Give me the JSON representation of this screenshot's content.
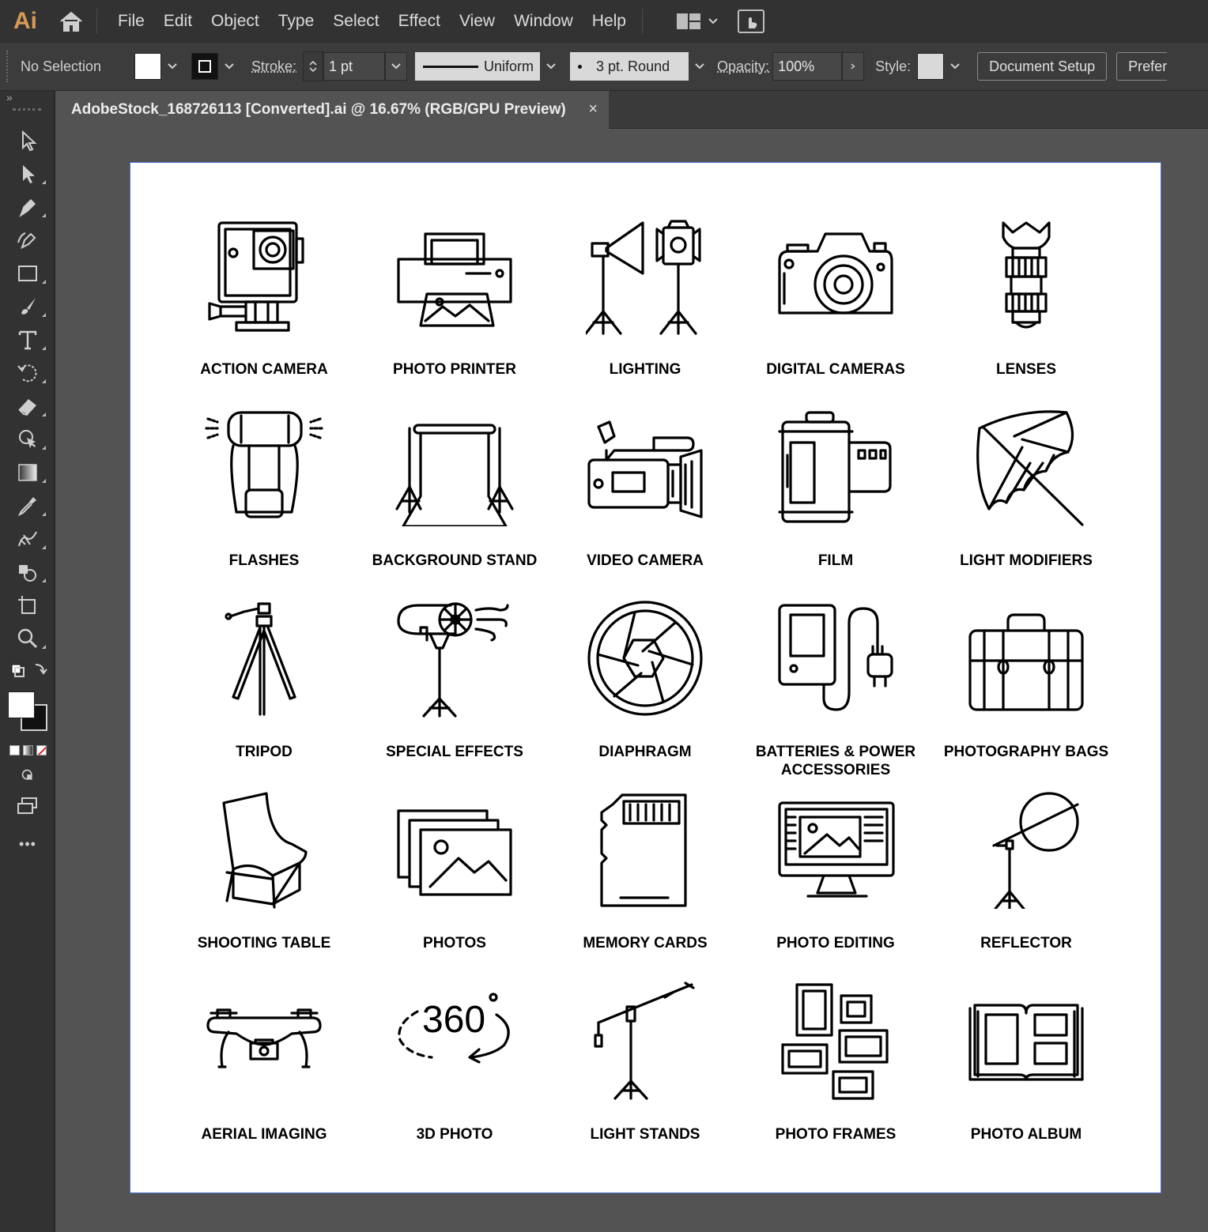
{
  "app": {
    "logo": "Ai"
  },
  "menu": [
    "File",
    "Edit",
    "Object",
    "Type",
    "Select",
    "Effect",
    "View",
    "Window",
    "Help"
  ],
  "control": {
    "selection": "No Selection",
    "stroke_label": "Stroke:",
    "stroke_value": "1 pt",
    "profile": "Uniform",
    "brush": "3 pt. Round",
    "opacity_label": "Opacity:",
    "opacity_value": "100%",
    "style_label": "Style:",
    "document_setup": "Document Setup",
    "preferences": "Prefere"
  },
  "toolbar": {
    "collapse": "»",
    "tools": [
      "selection-tool",
      "direct-selection-tool",
      "pen-tool",
      "curvature-tool",
      "rectangle-tool",
      "paintbrush-tool",
      "type-tool",
      "rotate-tool",
      "eraser-tool",
      "puppet-warp-tool",
      "gradient-tool",
      "eyedropper-tool",
      "blend-tool",
      "shape-builder-tool",
      "artboard-tool",
      "zoom-tool"
    ],
    "more": "•••"
  },
  "document": {
    "tab_title": "AdobeStock_168726113 [Converted].ai @ 16.67% (RGB/GPU Preview)",
    "close": "×"
  },
  "icons": [
    "ACTION CAMERA",
    "PHOTO PRINTER",
    "LIGHTING",
    "DIGITAL CAMERAS",
    "LENSES",
    "FLASHES",
    "BACKGROUND STAND",
    "VIDEO CAMERA",
    "FILM",
    "LIGHT MODIFIERS",
    "TRIPOD",
    "SPECIAL EFFECTS",
    "DIAPHRAGM",
    "BATTERIES & POWER ACCESSORIES",
    "PHOTOGRAPHY BAGS",
    "SHOOTING TABLE",
    "PHOTOS",
    "MEMORY CARDS",
    "PHOTO EDITING",
    "REFLECTOR",
    "AERIAL IMAGING",
    "3D PHOTO",
    "LIGHT STANDS",
    "PHOTO FRAMES",
    "PHOTO ALBUM"
  ],
  "icon_names": [
    "action-camera-icon",
    "photo-printer-icon",
    "lighting-icon",
    "digital-camera-icon",
    "lens-icon",
    "flash-icon",
    "background-stand-icon",
    "video-camera-icon",
    "film-icon",
    "umbrella-icon",
    "tripod-icon",
    "special-effects-icon",
    "aperture-icon",
    "battery-charger-icon",
    "camera-bag-icon",
    "shooting-table-icon",
    "photos-icon",
    "memory-card-icon",
    "photo-editing-icon",
    "reflector-icon",
    "drone-icon",
    "360-photo-icon",
    "boom-stand-icon",
    "photo-frames-icon",
    "photo-album-icon"
  ],
  "text_360": "360",
  "colors": {
    "accent": "#d89a55",
    "artboard_border": "#4a6fd0"
  }
}
